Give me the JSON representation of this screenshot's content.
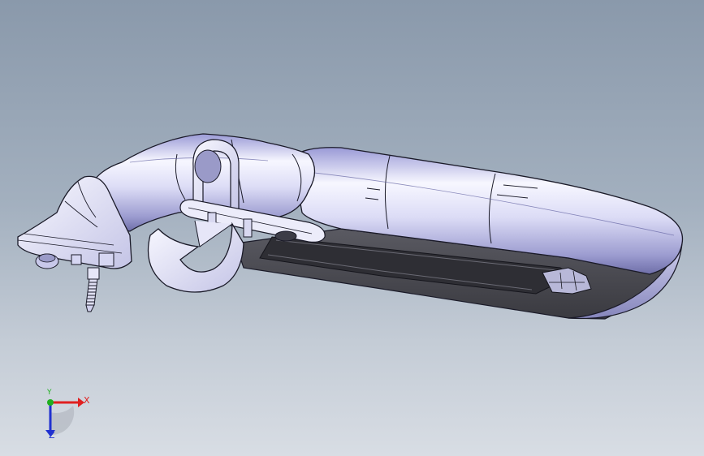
{
  "triad": {
    "x_label": "X",
    "y_label": "Y",
    "z_label": "Z",
    "x_color": "#e02020",
    "y_color": "#20b020",
    "z_color": "#2030d0"
  },
  "colors": {
    "background_top": "#8a99ab",
    "background_bottom": "#d8dde4",
    "body_highlight": "#f4f4ff",
    "body_shade": "#8c8cc8",
    "edge_line": "#1a1a28",
    "dark_underside": "#4a4a52"
  }
}
